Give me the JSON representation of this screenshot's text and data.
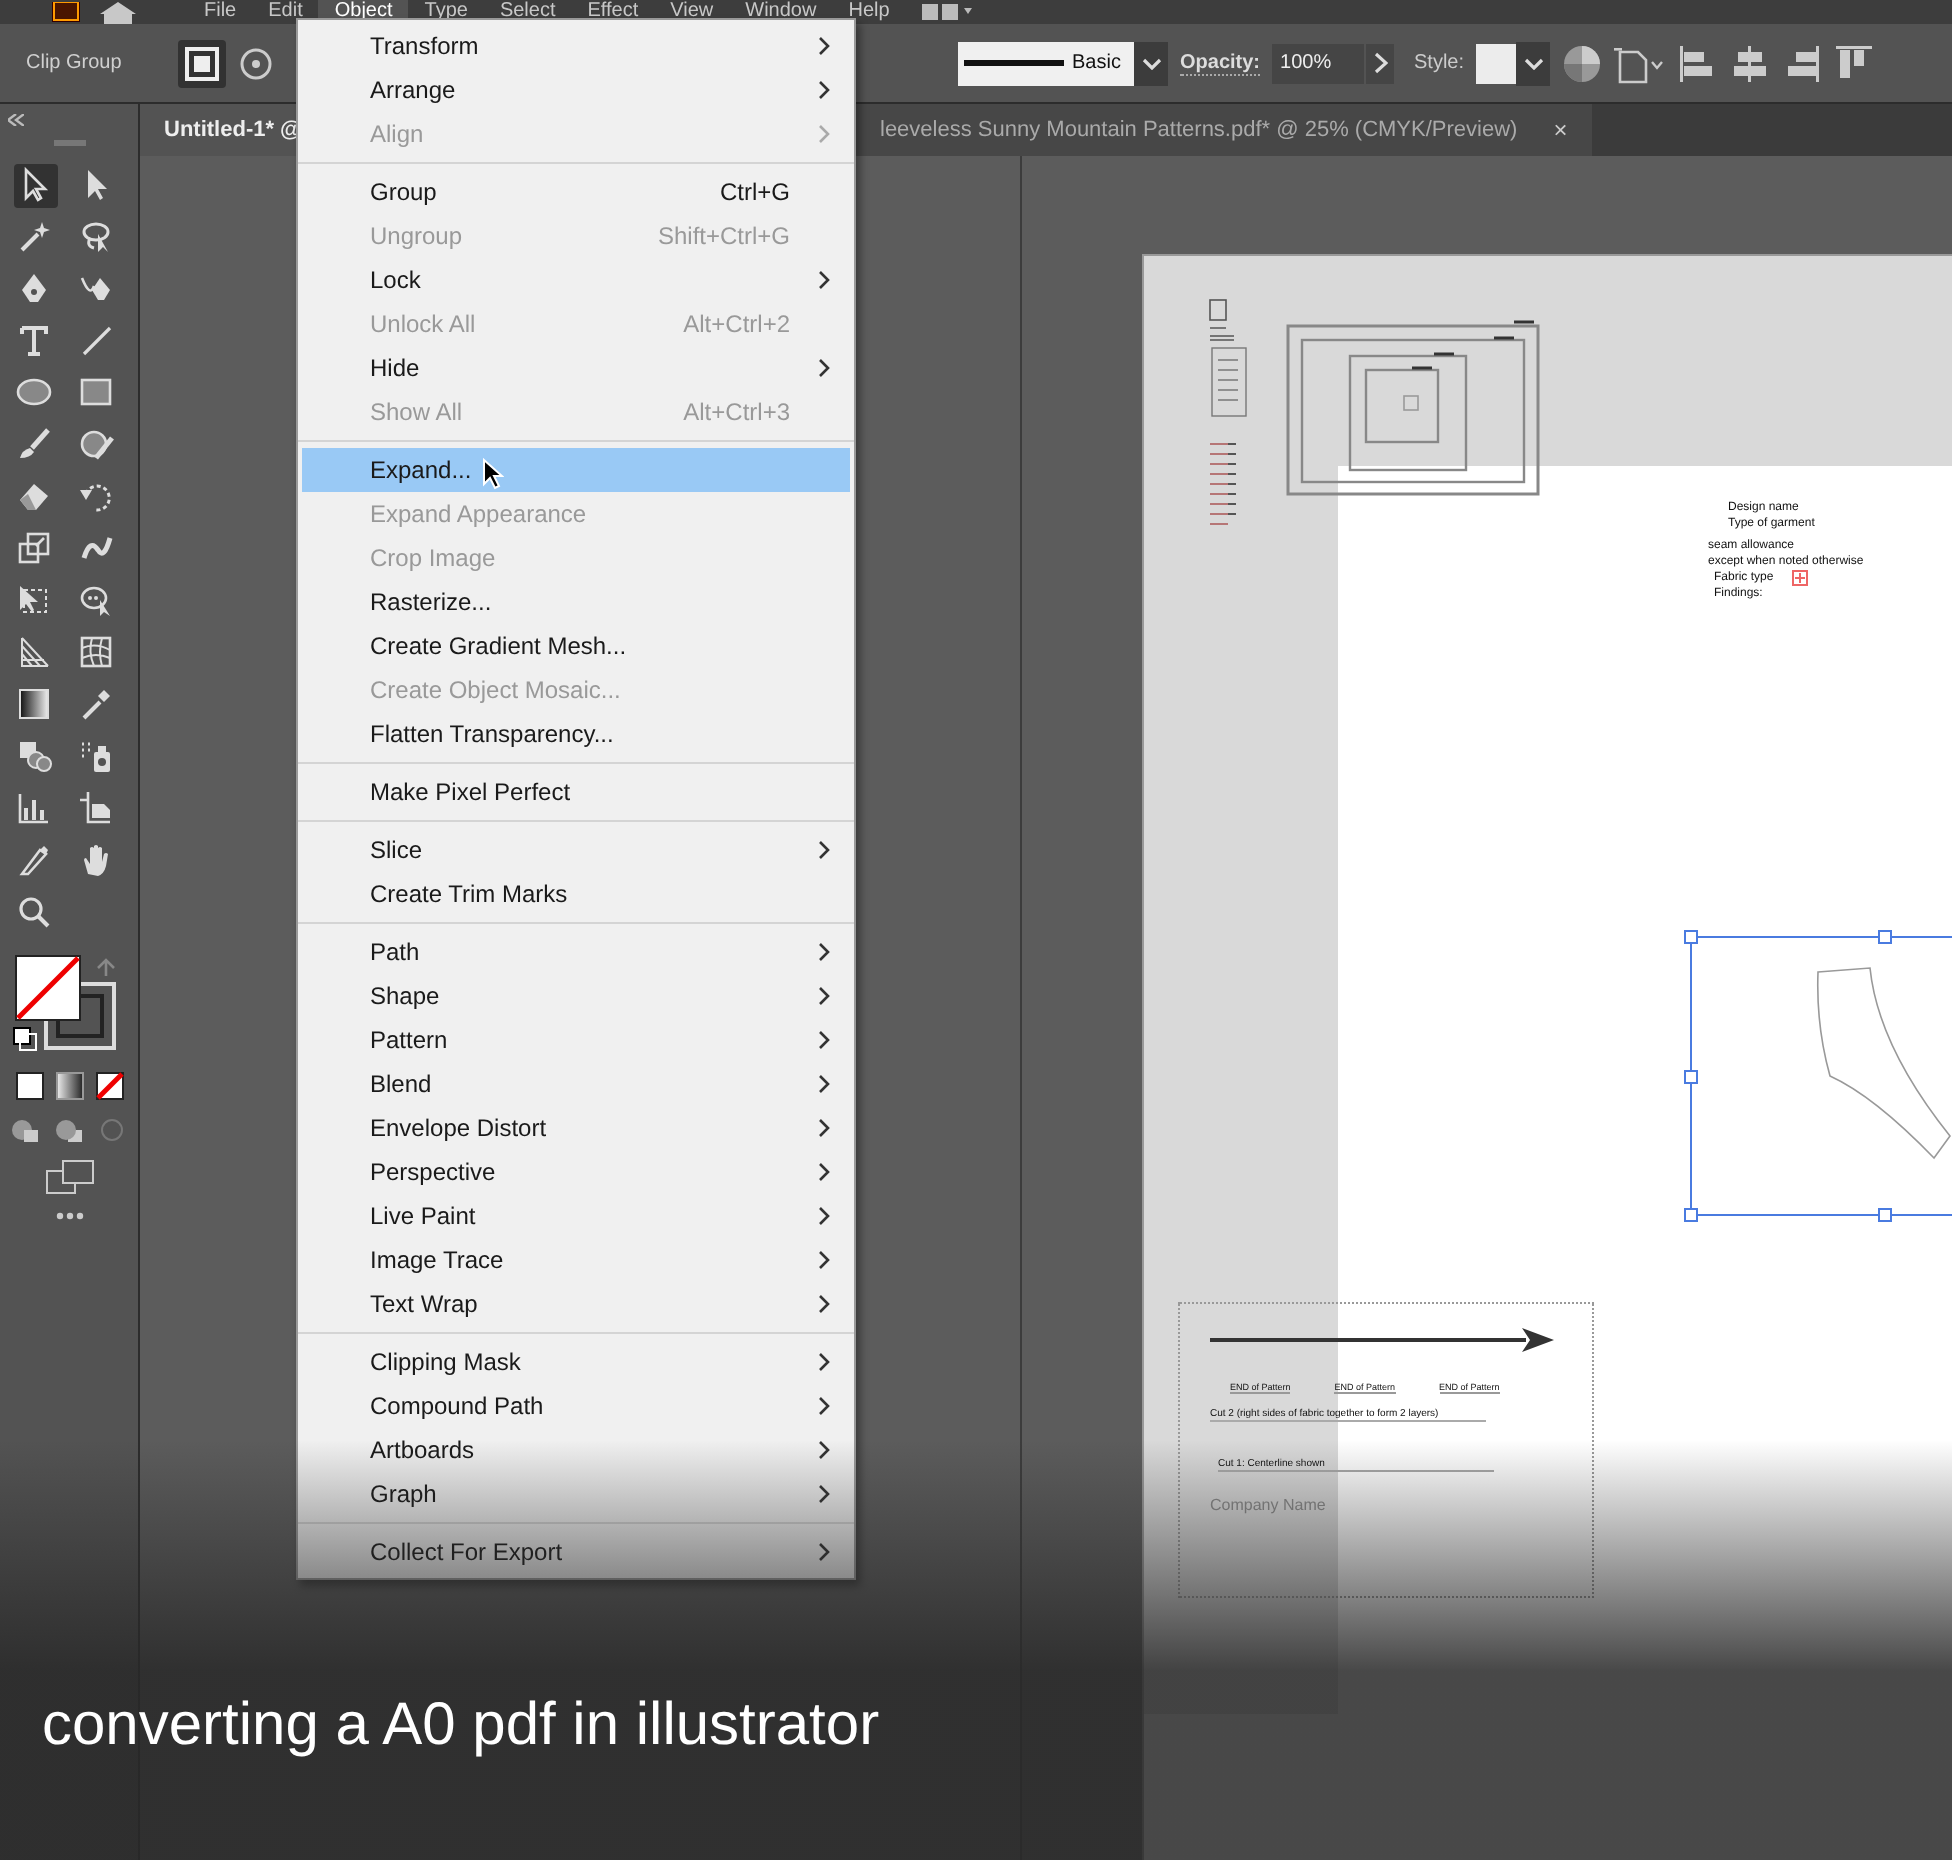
{
  "menubar": [
    {
      "label": "File",
      "selected": false
    },
    {
      "label": "Edit",
      "selected": false
    },
    {
      "label": "Object",
      "selected": true
    },
    {
      "label": "Type",
      "selected": false
    },
    {
      "label": "Select",
      "selected": false
    },
    {
      "label": "Effect",
      "selected": false
    },
    {
      "label": "View",
      "selected": false
    },
    {
      "label": "Window",
      "selected": false
    },
    {
      "label": "Help",
      "selected": false
    }
  ],
  "control_bar": {
    "selection_label": "Clip Group",
    "stroke_style": "Basic",
    "opacity_label": "Opacity:",
    "opacity_value": "100%",
    "style_label": "Style:"
  },
  "tabs": [
    {
      "label": "Untitled-1* @",
      "selected": true
    },
    {
      "label": "leeveless Sunny Mountain Patterns.pdf* @ 25% (CMYK/Preview)",
      "selected": false,
      "close": "×"
    }
  ],
  "toolbar": {
    "tools": [
      {
        "selected": true
      },
      {
        "selected": false
      },
      {
        "selected": false
      },
      {
        "selected": false
      },
      {
        "selected": false
      },
      {
        "selected": false
      },
      {
        "selected": false
      },
      {
        "selected": false
      },
      {
        "selected": false
      },
      {
        "selected": false
      },
      {
        "selected": false
      },
      {
        "selected": false
      },
      {
        "selected": false
      },
      {
        "selected": false
      },
      {
        "selected": false
      },
      {
        "selected": false
      },
      {
        "selected": false
      },
      {
        "selected": false
      },
      {
        "selected": false
      },
      {
        "selected": false
      },
      {
        "selected": false
      },
      {
        "selected": false
      },
      {
        "selected": false
      },
      {
        "selected": false
      },
      {
        "selected": false
      },
      {
        "selected": false
      },
      {
        "selected": false
      },
      {
        "selected": false
      },
      {
        "selected": false
      }
    ]
  },
  "object_menu": {
    "groups": [
      [
        {
          "label": "Transform",
          "submenu": true,
          "disabled": false,
          "selected": false
        },
        {
          "label": "Arrange",
          "submenu": true,
          "disabled": false,
          "selected": false
        },
        {
          "label": "Align",
          "submenu": true,
          "disabled": true,
          "selected": false
        }
      ],
      [
        {
          "label": "Group",
          "shortcut": "Ctrl+G",
          "submenu": false,
          "disabled": false,
          "selected": false
        },
        {
          "label": "Ungroup",
          "shortcut": "Shift+Ctrl+G",
          "submenu": false,
          "disabled": true,
          "selected": false
        },
        {
          "label": "Lock",
          "submenu": true,
          "disabled": false,
          "selected": false
        },
        {
          "label": "Unlock All",
          "shortcut": "Alt+Ctrl+2",
          "submenu": false,
          "disabled": true,
          "selected": false
        },
        {
          "label": "Hide",
          "submenu": true,
          "disabled": false,
          "selected": false
        },
        {
          "label": "Show All",
          "shortcut": "Alt+Ctrl+3",
          "submenu": false,
          "disabled": true,
          "selected": false
        }
      ],
      [
        {
          "label": "Expand...",
          "submenu": false,
          "disabled": false,
          "selected": true
        },
        {
          "label": "Expand Appearance",
          "submenu": false,
          "disabled": true,
          "selected": false
        },
        {
          "label": "Crop Image",
          "submenu": false,
          "disabled": true,
          "selected": false
        },
        {
          "label": "Rasterize...",
          "submenu": false,
          "disabled": false,
          "selected": false
        },
        {
          "label": "Create Gradient Mesh...",
          "submenu": false,
          "disabled": false,
          "selected": false
        },
        {
          "label": "Create Object Mosaic...",
          "submenu": false,
          "disabled": true,
          "selected": false
        },
        {
          "label": "Flatten Transparency...",
          "submenu": false,
          "disabled": false,
          "selected": false
        }
      ],
      [
        {
          "label": "Make Pixel Perfect",
          "submenu": false,
          "disabled": false,
          "selected": false
        }
      ],
      [
        {
          "label": "Slice",
          "submenu": true,
          "disabled": false,
          "selected": false
        },
        {
          "label": "Create Trim Marks",
          "submenu": false,
          "disabled": false,
          "selected": false
        }
      ],
      [
        {
          "label": "Path",
          "submenu": true,
          "disabled": false,
          "selected": false
        },
        {
          "label": "Shape",
          "submenu": true,
          "disabled": false,
          "selected": false
        },
        {
          "label": "Pattern",
          "submenu": true,
          "disabled": false,
          "selected": false
        },
        {
          "label": "Blend",
          "submenu": true,
          "disabled": false,
          "selected": false
        },
        {
          "label": "Envelope Distort",
          "submenu": true,
          "disabled": false,
          "selected": false
        },
        {
          "label": "Perspective",
          "submenu": true,
          "disabled": false,
          "selected": false
        },
        {
          "label": "Live Paint",
          "submenu": true,
          "disabled": false,
          "selected": false
        },
        {
          "label": "Image Trace",
          "submenu": true,
          "disabled": false,
          "selected": false
        },
        {
          "label": "Text Wrap",
          "submenu": true,
          "disabled": false,
          "selected": false
        }
      ],
      [
        {
          "label": "Clipping Mask",
          "submenu": true,
          "disabled": false,
          "selected": false
        },
        {
          "label": "Compound Path",
          "submenu": true,
          "disabled": false,
          "selected": false
        },
        {
          "label": "Artboards",
          "submenu": true,
          "disabled": false,
          "selected": false
        },
        {
          "label": "Graph",
          "submenu": true,
          "disabled": false,
          "selected": false
        }
      ],
      [
        {
          "label": "Collect For Export",
          "submenu": true,
          "disabled": false,
          "selected": false
        }
      ]
    ]
  },
  "artboard": {
    "info_lines": [
      "Design name",
      "Type of garment"
    ],
    "notes": [
      "seam allowance",
      "except when noted otherwise",
      "Fabric type",
      "Findings:"
    ],
    "pattern_label": {
      "ends": [
        "END of Pattern",
        "END of Pattern",
        "END of Pattern"
      ],
      "cut_lines": [
        "Cut 2 (right sides of fabric together to form 2 layers)",
        "Cut 1: Centerline shown"
      ],
      "company": "Company Name"
    }
  },
  "caption": "converting a A0 pdf in illustrator"
}
